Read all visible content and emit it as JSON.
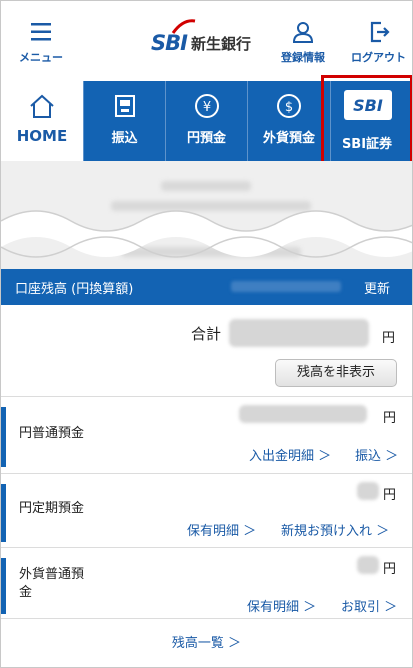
{
  "header": {
    "menu_label": "メニュー",
    "logo_sbi": "SBI",
    "logo_bank": "新生銀行",
    "register_label": "登録情報",
    "logout_label": "ログアウト"
  },
  "nav": {
    "home": "HOME",
    "transfer": "振込",
    "yen_deposit": "円預金",
    "fx_deposit": "外貨預金",
    "sbi_securities": "SBI証券",
    "sbi_badge": "SBI"
  },
  "balance": {
    "title": "口座残高 (円換算額)",
    "update": "更新",
    "total_label": "合計",
    "yen": "円",
    "hide_button": "残高を非表示"
  },
  "accounts": [
    {
      "name": "円普通預金",
      "yen": "円",
      "links": [
        "入出金明細 ＞",
        "振込 ＞"
      ]
    },
    {
      "name": "円定期預金",
      "yen": "円",
      "links": [
        "保有明細 ＞",
        "新規お預け入れ ＞"
      ]
    },
    {
      "name": "外貨普通預\n金",
      "yen": "円",
      "links": [
        "保有明細 ＞",
        "お取引 ＞"
      ]
    }
  ],
  "footer": {
    "balance_list": "残高一覧 ＞"
  },
  "colors": {
    "brand_blue": "#1363b3",
    "link_blue": "#1a5aa6",
    "highlight_red": "#d10000"
  }
}
